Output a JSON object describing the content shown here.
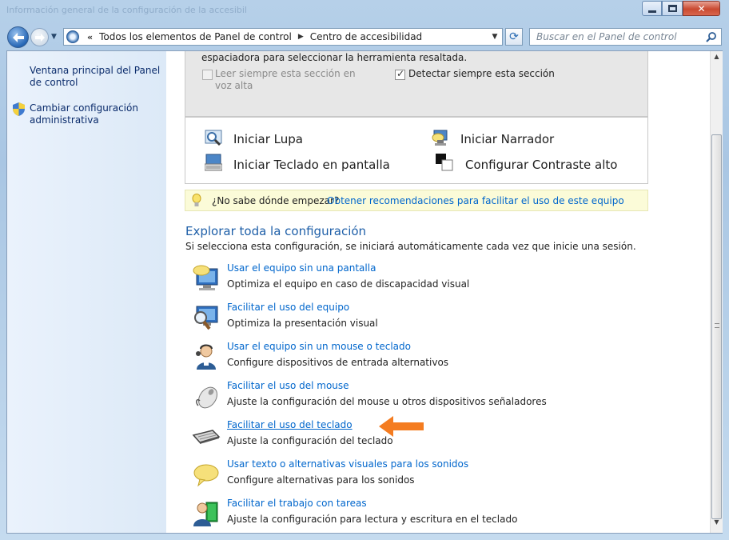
{
  "window": {
    "title_ghost": "Información general de la configuración de la accesibilidad del teclado"
  },
  "nav": {
    "breadcrumb": [
      "Todos los elementos de Panel de control",
      "Centro de accesibilidad"
    ],
    "search_placeholder": "Buscar en el Panel de control"
  },
  "sidebar": {
    "items": [
      {
        "label": "Ventana principal del Panel de control"
      },
      {
        "label": "Cambiar configuración administrativa"
      }
    ]
  },
  "top_section": {
    "partial_text": "Windows puede leer y analizar esta lista automáticamente. Presione la barra espaciadora para seleccionar la herramienta resaltada.",
    "checkbox_always_read": {
      "label": "Leer siempre esta sección en voz alta",
      "checked": false
    },
    "checkbox_always_scan": {
      "label": "Detectar siempre esta sección",
      "checked": true
    }
  },
  "quick_start": [
    {
      "label": "Iniciar Lupa",
      "icon": "magnifier-icon"
    },
    {
      "label": "Iniciar Narrador",
      "icon": "narrator-icon"
    },
    {
      "label": "Iniciar Teclado en pantalla",
      "icon": "on-screen-keyboard-icon"
    },
    {
      "label": "Configurar Contraste alto",
      "icon": "high-contrast-icon"
    }
  ],
  "tip": {
    "question": "¿No sabe dónde empezar?",
    "link": "Obtener recomendaciones para facilitar el uso de este equipo"
  },
  "explore": {
    "heading": "Explorar toda la configuración",
    "subtitle": "Si selecciona esta configuración, se iniciará automáticamente cada vez que inicie una sesión.",
    "options": [
      {
        "link": "Usar el equipo sin una pantalla",
        "desc": "Optimiza el equipo en caso de discapacidad visual",
        "icon": "monitor-speech-icon"
      },
      {
        "link": "Facilitar el uso del equipo",
        "desc": "Optimiza la presentación visual",
        "icon": "monitor-magnifier-icon"
      },
      {
        "link": "Usar el equipo sin un mouse o teclado",
        "desc": "Configure dispositivos de entrada alternativos",
        "icon": "user-headset-icon"
      },
      {
        "link": "Facilitar el uso del mouse",
        "desc": "Ajuste la configuración del mouse u otros dispositivos señaladores",
        "icon": "mouse-icon"
      },
      {
        "link": "Facilitar el uso del teclado",
        "desc": "Ajuste la configuración del teclado",
        "icon": "keyboard-icon"
      },
      {
        "link": "Usar texto o alternativas visuales para los sonidos",
        "desc": "Configure alternativas para los sonidos",
        "icon": "speech-bubble-icon"
      },
      {
        "link": "Facilitar el trabajo con tareas",
        "desc": "Ajuste la configuración para lectura y escritura en el teclado",
        "icon": "user-book-icon"
      }
    ]
  },
  "colors": {
    "link": "#0066cc",
    "heading": "#1e5fa8",
    "arrow": "#f47c20"
  }
}
